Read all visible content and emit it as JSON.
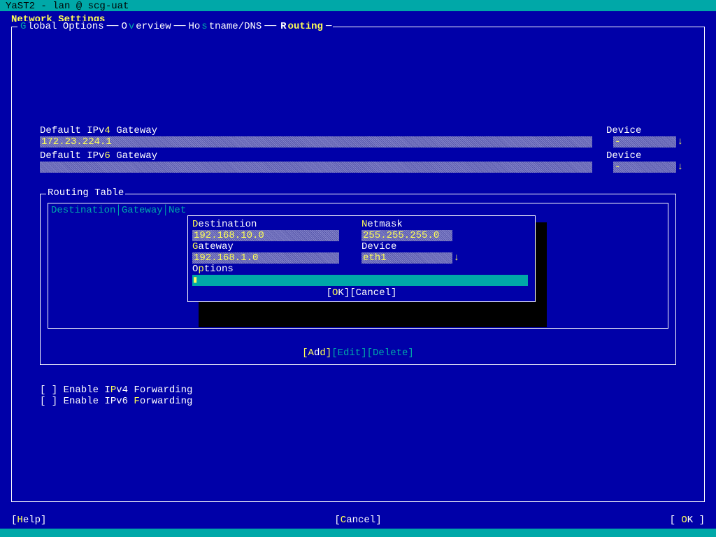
{
  "titlebar": "YaST2 - lan @ scg-uat",
  "page_title": "Network Settings",
  "tabs": {
    "global": "Global Options",
    "overview": "Overview",
    "hostname": "Hostname/DNS",
    "routing": "Routing"
  },
  "gateway": {
    "ipv4_label_pre": "Default IPv",
    "ipv4_label_hot": "4",
    "ipv4_label_post": " Gateway",
    "ipv4_value": "172.23.224.1",
    "ipv6_label_pre": "Default IPv",
    "ipv6_label_hot": "6",
    "ipv6_label_post": " Gateway",
    "ipv6_value": "",
    "device_label": "Device",
    "device_value": "-"
  },
  "routing": {
    "title": "Routing Table",
    "header": "Destination│Gateway│Net",
    "buttons": {
      "add": "[Add]",
      "edit": "[Edit]",
      "delete": "[Delete]"
    }
  },
  "modal": {
    "dest_label": "Destination",
    "dest_value": "192.168.10.0",
    "netmask_label": "Netmask",
    "netmask_value": "255.255.255.0",
    "gateway_label": "Gateway",
    "gateway_value": "192.168.1.0",
    "device_label": "Device",
    "device_value": "eth1",
    "options_label": "Options",
    "options_value": "",
    "ok": "[OK]",
    "cancel": "[Cancel]"
  },
  "checkboxes": {
    "ipv4": "[ ] Enable IPv4 Forwarding",
    "ipv6": "[ ] Enable IPv6 Forwarding"
  },
  "bottom": {
    "help": "[Help]",
    "cancel": "[Cancel]",
    "ok": "[ OK ]"
  }
}
